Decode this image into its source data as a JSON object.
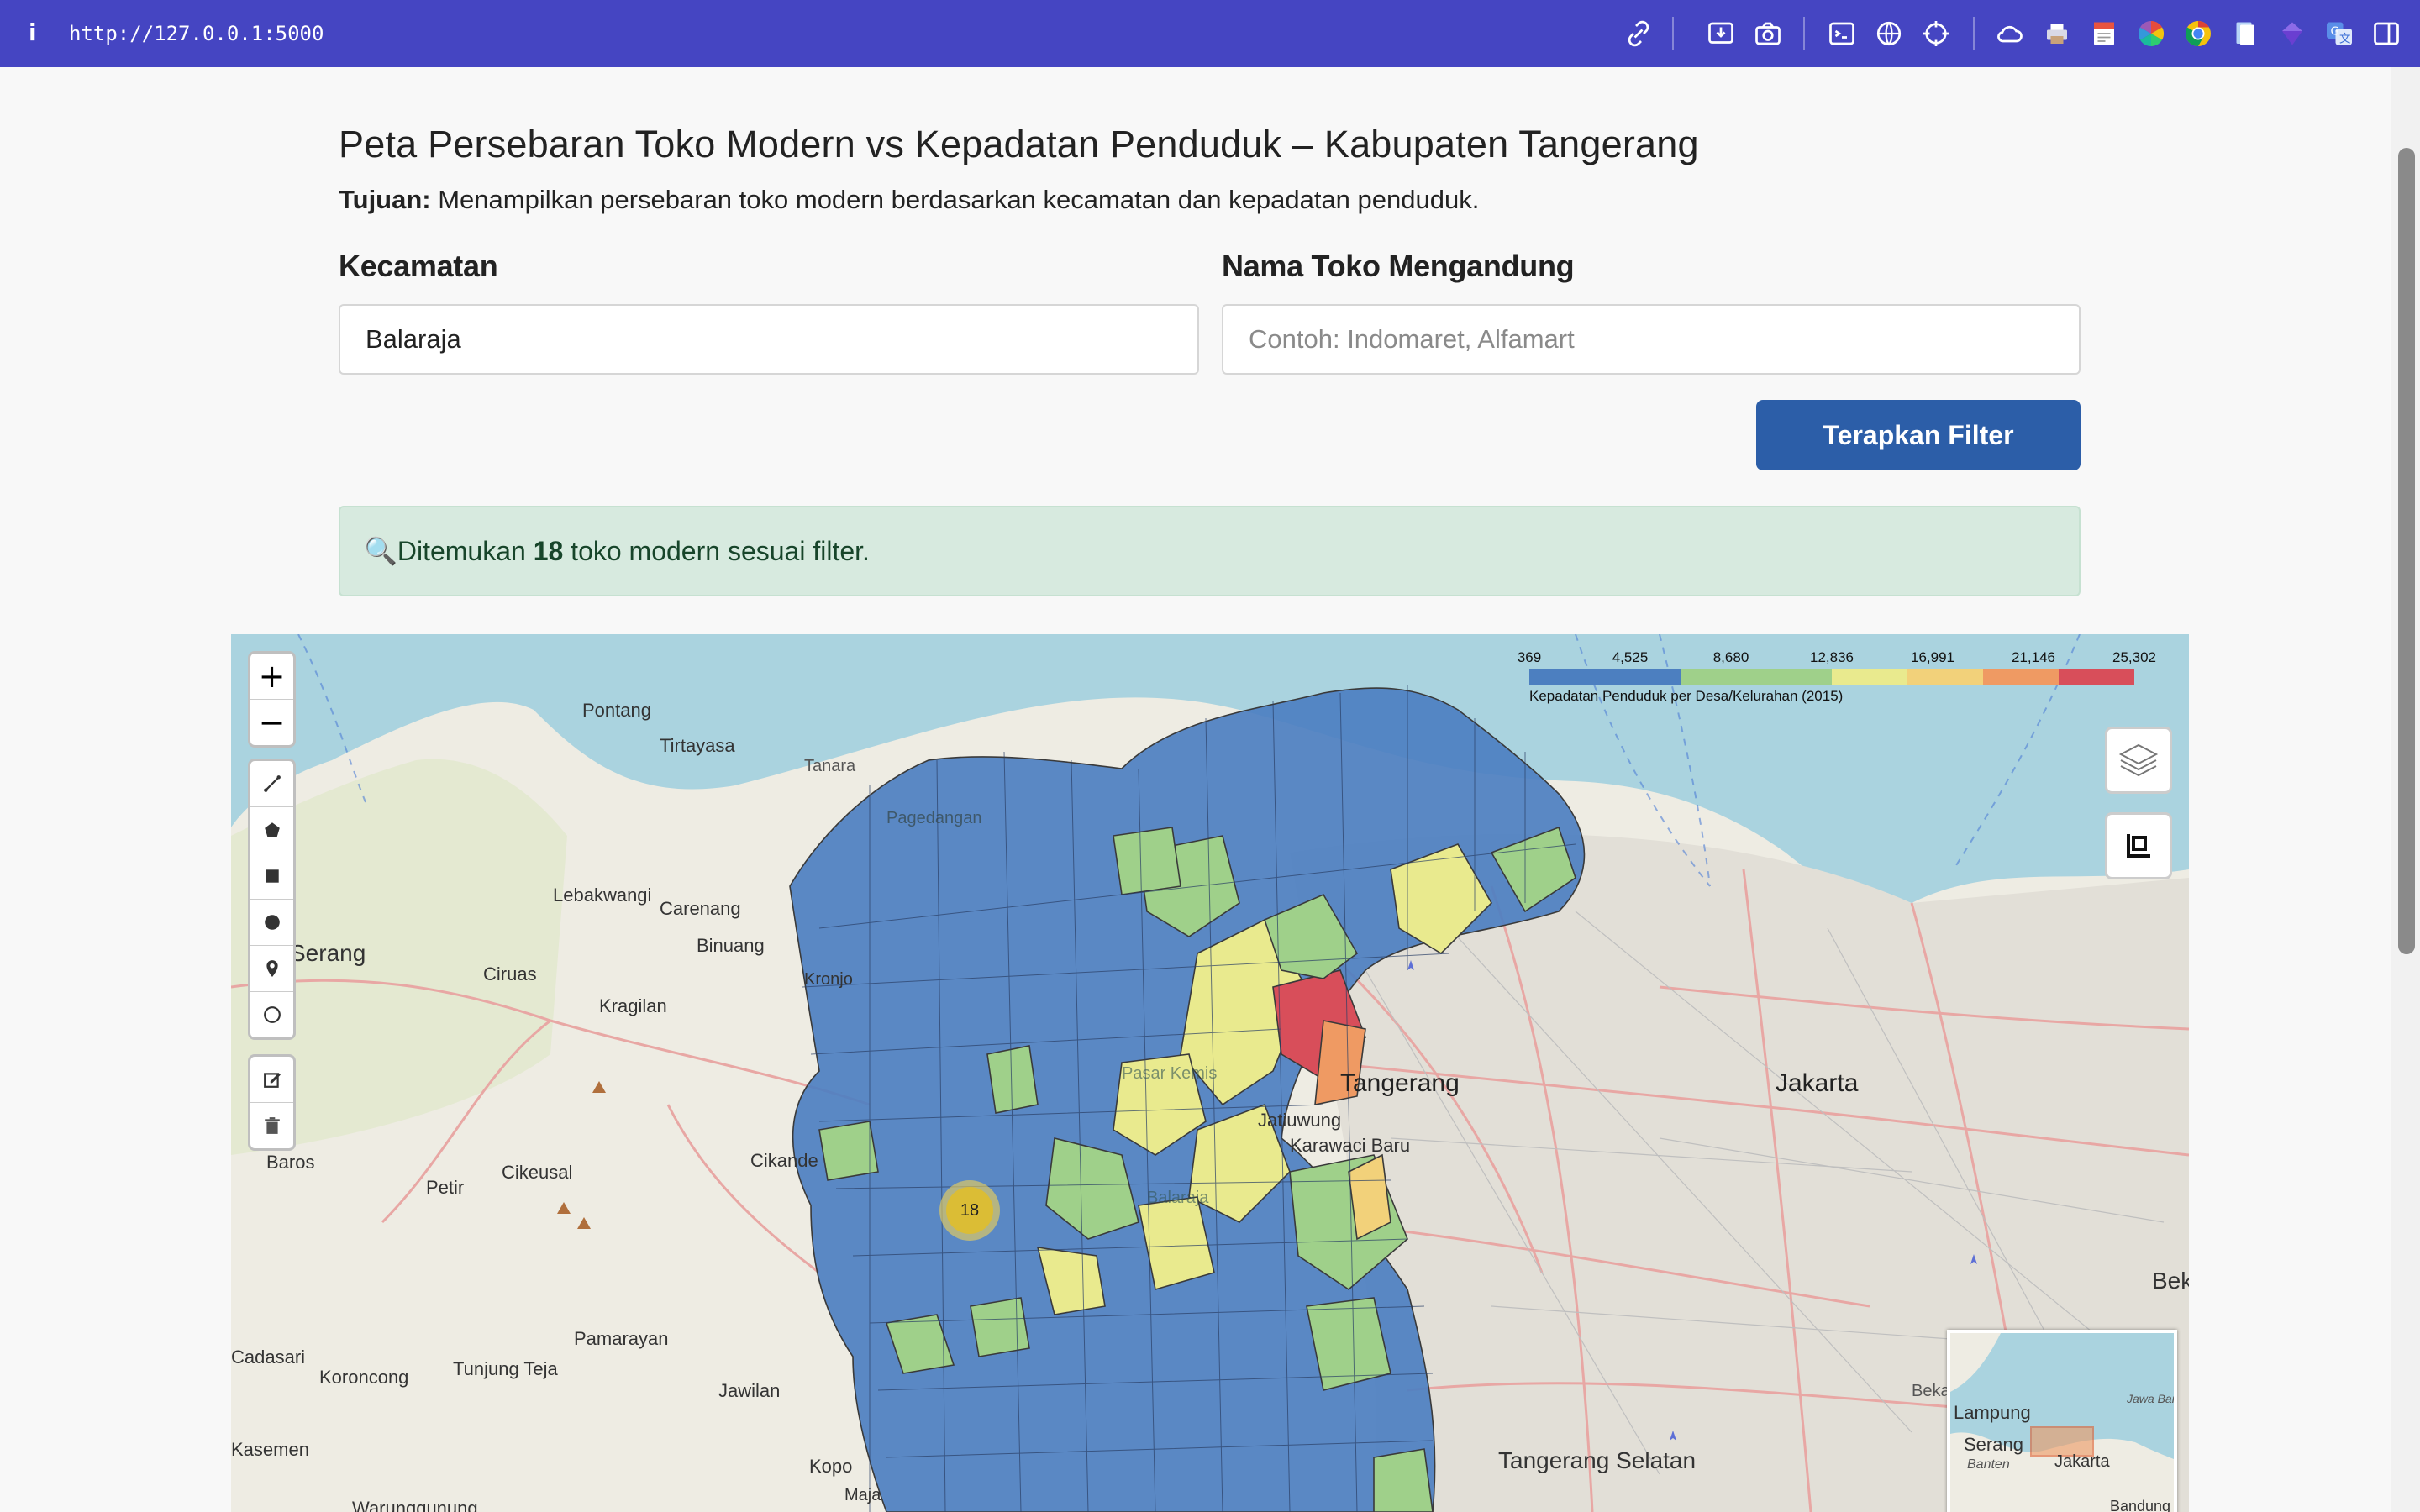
{
  "browser": {
    "info_icon": "info-icon",
    "url": "http://127.0.0.1:5000",
    "toolbar_icons": [
      "link-icon",
      "download-box-icon",
      "camera-icon",
      "terminal-icon",
      "globe-icon",
      "crosshair-icon",
      "cloud-icon",
      "printer-icon",
      "note-icon",
      "color-wheel-icon",
      "chrome-circle-icon",
      "document-icon",
      "purple-gem-icon",
      "translate-icon",
      "sidebar-icon"
    ]
  },
  "page": {
    "title": "Peta Persebaran Toko Modern vs Kepadatan Penduduk – Kabupaten Tangerang",
    "purpose_label": "Tujuan:",
    "purpose_text": " Menampilkan persebaran toko modern berdasarkan kecamatan dan kepadatan penduduk."
  },
  "filters": {
    "kecamatan_label": "Kecamatan",
    "kecamatan_value": "Balaraja",
    "nama_label": "Nama Toko Mengandung",
    "nama_value": "",
    "nama_placeholder": "Contoh: Indomaret, Alfamart",
    "apply_button": "Terapkan Filter"
  },
  "result": {
    "icon": "🔍",
    "prefix": "Ditemukan ",
    "count": "18",
    "suffix": " toko modern sesuai filter."
  },
  "map": {
    "zoom_in": "+",
    "zoom_out": "−",
    "draw_tools": [
      "polyline-icon",
      "polygon-icon",
      "rectangle-icon",
      "circle-icon",
      "marker-icon",
      "circlemarker-icon"
    ],
    "edit_tools": [
      "edit-icon",
      "trash-icon"
    ],
    "cluster_count": "18",
    "legend": {
      "ticks": [
        "369",
        "4,525",
        "8,680",
        "12,836",
        "16,991",
        "21,146",
        "25,302"
      ],
      "colors": [
        "#4c7fc0",
        "#4c7fc0",
        "#9fd08a",
        "#9fd08a",
        "#e9ea8e",
        "#f2d17a",
        "#ef9a63",
        "#d84e5a"
      ],
      "caption": "Kepadatan Penduduk per Desa/Kelurahan (2015)"
    },
    "places": [
      "Pontang",
      "Tirtayasa",
      "Tanara",
      "Pagedangan",
      "Lebakwangi",
      "Carenang",
      "Binuang",
      "Serang",
      "Ciruas",
      "Kragilan",
      "Kronjo",
      "Baros",
      "Petir",
      "Cikeusal",
      "Cikande",
      "Pamarayan",
      "Koroncong",
      "Tunjung Teja",
      "Jawilan",
      "Cadasari",
      "Warunggunung",
      "Kasemen",
      "Kopo",
      "Maja",
      "Tangerang",
      "Jatiuwung",
      "Karawaci Baru",
      "Jakarta",
      "Tangerang Selatan",
      "Bekasi",
      "Bek",
      "Pasar Kemis",
      "Balaraja"
    ],
    "minimap_places": [
      "Lampung",
      "Serang",
      "Banten",
      "Jakarta",
      "Jawa Barat",
      "Bandung"
    ]
  }
}
